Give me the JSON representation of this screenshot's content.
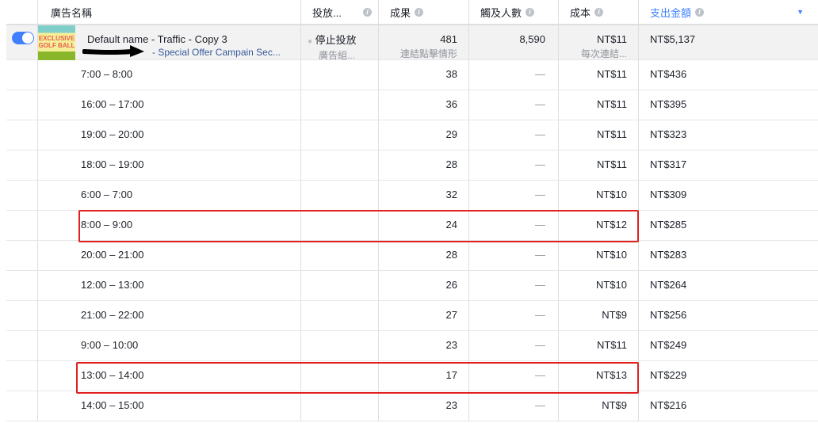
{
  "header": {
    "name": "廣告名稱",
    "delivery": "投放...",
    "results": "成果",
    "reach": "觸及人數",
    "cost": "成本",
    "spend": "支出金額"
  },
  "ad": {
    "enabled": true,
    "thumbnail_text": "EXCLUSIVE GOLF BALL",
    "name": "Default name - Traffic - Copy 3",
    "campaign": "- Special Offer Campain Sec...",
    "delivery": "停止投放",
    "delivery_sub": "廣告組...",
    "results": "481",
    "results_sub": "連結點擊情形",
    "reach": "8,590",
    "cost": "NT$11",
    "cost_sub": "每次連結...",
    "spend": "NT$5,137"
  },
  "rows": [
    {
      "time": "7:00 – 8:00",
      "results": "38",
      "reach": "—",
      "cost": "NT$11",
      "spend": "NT$436"
    },
    {
      "time": "16:00 – 17:00",
      "results": "36",
      "reach": "—",
      "cost": "NT$11",
      "spend": "NT$395"
    },
    {
      "time": "19:00 – 20:00",
      "results": "29",
      "reach": "—",
      "cost": "NT$11",
      "spend": "NT$323"
    },
    {
      "time": "18:00 – 19:00",
      "results": "28",
      "reach": "—",
      "cost": "NT$11",
      "spend": "NT$317"
    },
    {
      "time": "6:00 – 7:00",
      "results": "32",
      "reach": "—",
      "cost": "NT$10",
      "spend": "NT$309"
    },
    {
      "time": "8:00 – 9:00",
      "results": "24",
      "reach": "—",
      "cost": "NT$12",
      "spend": "NT$285"
    },
    {
      "time": "20:00 – 21:00",
      "results": "28",
      "reach": "—",
      "cost": "NT$10",
      "spend": "NT$283"
    },
    {
      "time": "12:00 – 13:00",
      "results": "26",
      "reach": "—",
      "cost": "NT$10",
      "spend": "NT$264"
    },
    {
      "time": "21:00 – 22:00",
      "results": "27",
      "reach": "—",
      "cost": "NT$9",
      "spend": "NT$256"
    },
    {
      "time": "9:00 – 10:00",
      "results": "23",
      "reach": "—",
      "cost": "NT$11",
      "spend": "NT$249"
    },
    {
      "time": "13:00 – 14:00",
      "results": "17",
      "reach": "—",
      "cost": "NT$13",
      "spend": "NT$229"
    },
    {
      "time": "14:00 – 15:00",
      "results": "23",
      "reach": "—",
      "cost": "NT$9",
      "spend": "NT$216"
    }
  ],
  "colors": {
    "accent": "#4080ff",
    "highlight": "#e02020"
  }
}
